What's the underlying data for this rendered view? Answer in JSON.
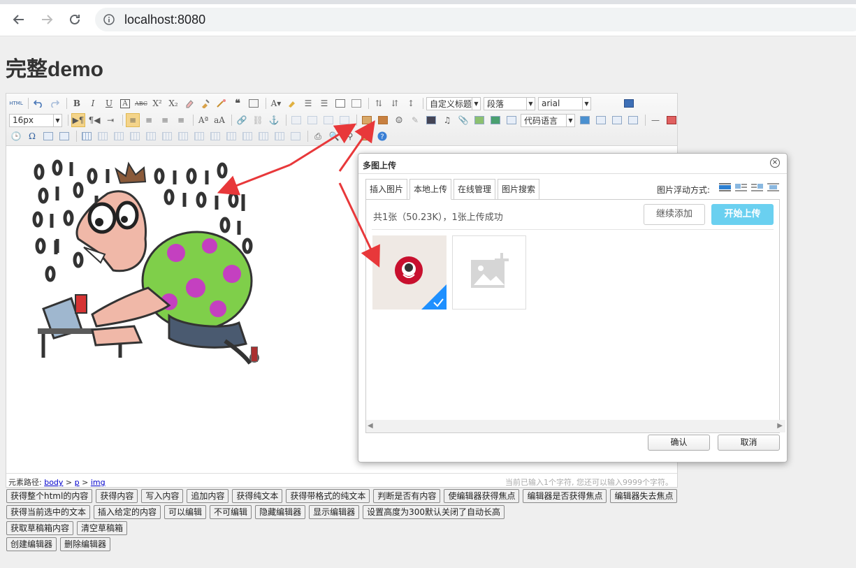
{
  "browser": {
    "url": "localhost:8080"
  },
  "page": {
    "title": "完整demo"
  },
  "toolbar": {
    "custom_heading": "自定义标题",
    "paragraph": "段落",
    "font_family": "arial",
    "font_size": "16px",
    "code_language": "代码语言",
    "html_label": "HTML"
  },
  "statusbar": {
    "path_label": "元素路径:",
    "path": [
      "body",
      "p",
      "img"
    ],
    "word_count": "当前已输入1个字符, 您还可以输入9999个字符。"
  },
  "buttons": {
    "row1": [
      "获得整个html的内容",
      "获得内容",
      "写入内容",
      "追加内容",
      "获得纯文本",
      "获得带格式的纯文本",
      "判断是否有内容",
      "使编辑器获得焦点",
      "编辑器是否获得焦点",
      "编辑器失去焦点"
    ],
    "row2": [
      "获得当前选中的文本",
      "插入给定的内容",
      "可以编辑",
      "不可编辑",
      "隐藏编辑器",
      "显示编辑器",
      "设置高度为300默认关闭了自动长高"
    ],
    "row3": [
      "获取草稿箱内容",
      "清空草稿箱"
    ],
    "row4": [
      "创建编辑器",
      "删除编辑器"
    ]
  },
  "dialog": {
    "title": "多图上传",
    "tabs": [
      "插入图片",
      "本地上传",
      "在线管理",
      "图片搜索"
    ],
    "active_tab": "本地上传",
    "float_label": "图片浮动方式:",
    "upload_status": "共1张（50.23K），1张上传成功",
    "continue_label": "继续添加",
    "start_label": "开始上传",
    "confirm_label": "确认",
    "cancel_label": "取消"
  },
  "colors": {
    "accent_blue": "#6ad0f0",
    "check_blue": "#1e90ff",
    "arrow_red": "#e8383a"
  }
}
